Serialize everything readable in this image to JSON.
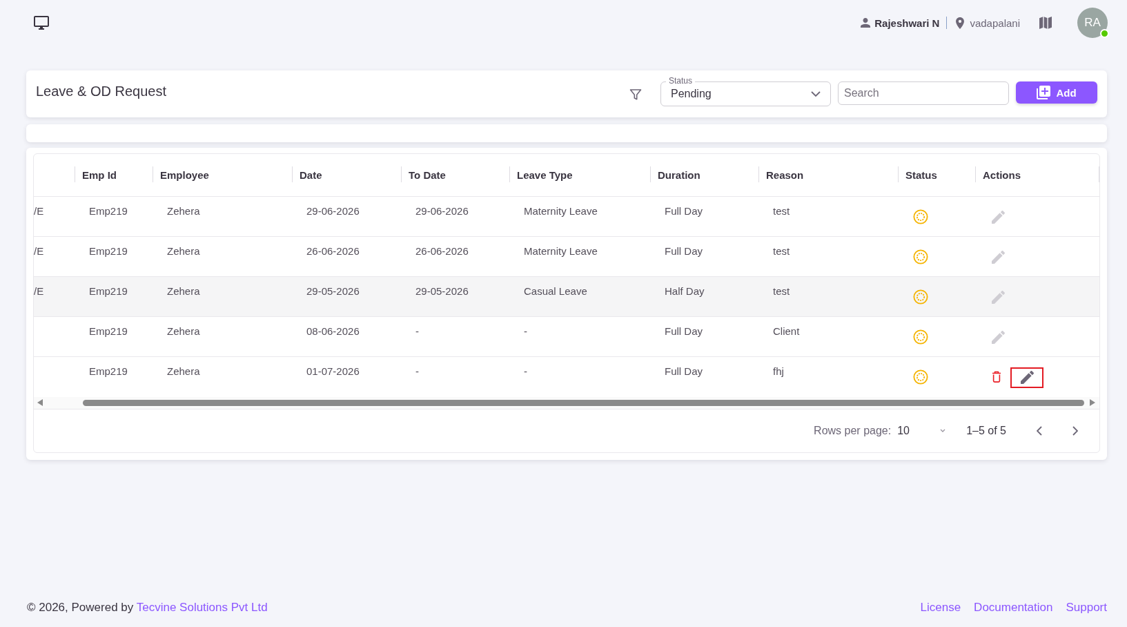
{
  "top_bar": {
    "user_name": "Rajeshwari N",
    "location": "vadapalani",
    "avatar": {
      "initials": "RA",
      "online": true
    }
  },
  "header": {
    "title": "Leave & OD Request",
    "status_filter": {
      "label": "Status",
      "value": "Pending"
    },
    "search": {
      "placeholder": "Search"
    },
    "add_button": "Add"
  },
  "table": {
    "columns": [
      {
        "label": "Emp Id",
        "kind": "text"
      },
      {
        "label": "Employee",
        "kind": "text"
      },
      {
        "label": "Date",
        "kind": "text"
      },
      {
        "label": "To Date",
        "kind": "text"
      },
      {
        "label": "Leave Type",
        "kind": "text"
      },
      {
        "label": "Duration",
        "kind": "text"
      },
      {
        "label": "Reason",
        "kind": "text"
      },
      {
        "label": "Status",
        "kind": "status"
      },
      {
        "label": "Actions",
        "kind": "actions"
      }
    ],
    "rows": [
      {
        "column_1": "/E",
        "cells": [
          "Emp219",
          "Zehera",
          "29-06-2026",
          "29-06-2026",
          "Maternity Leave",
          "Full Day",
          "test"
        ],
        "status": {
          "kind": "pending"
        },
        "highlighted": false,
        "can_delete": false,
        "edit_enabled": false,
        "edit_focused": false
      },
      {
        "column_1": "/E",
        "cells": [
          "Emp219",
          "Zehera",
          "26-06-2026",
          "26-06-2026",
          "Maternity Leave",
          "Full Day",
          "test"
        ],
        "status": {
          "kind": "pending"
        },
        "highlighted": false,
        "can_delete": false,
        "edit_enabled": false,
        "edit_focused": false
      },
      {
        "column_1": "/E",
        "cells": [
          "Emp219",
          "Zehera",
          "29-05-2026",
          "29-05-2026",
          "Casual Leave",
          "Half Day",
          "test"
        ],
        "status": {
          "kind": "pending"
        },
        "highlighted": true,
        "can_delete": false,
        "edit_enabled": false,
        "edit_focused": false
      },
      {
        "cells": [
          "Emp219",
          "Zehera",
          "08-06-2026",
          "-",
          "-",
          "Full Day",
          "Client"
        ],
        "status": {
          "kind": "pending"
        },
        "highlighted": false,
        "can_delete": false,
        "edit_enabled": false,
        "edit_focused": false
      },
      {
        "cells": [
          "Emp219",
          "Zehera",
          "01-07-2026",
          "-",
          "-",
          "Full Day",
          "fhj"
        ],
        "status": {
          "kind": "pending"
        },
        "highlighted": false,
        "can_delete": true,
        "edit_enabled": true,
        "edit_focused": true
      }
    ],
    "pagination": {
      "rows_per_page_label": "Rows per page:",
      "rows_per_page": "10",
      "range": "1–5 of 5"
    }
  },
  "footer": {
    "copyright": "© 2026, Powered by",
    "company_link": "Tecvine Solutions Pvt Ltd",
    "links": [
      "License",
      "Documentation",
      "Support"
    ]
  }
}
